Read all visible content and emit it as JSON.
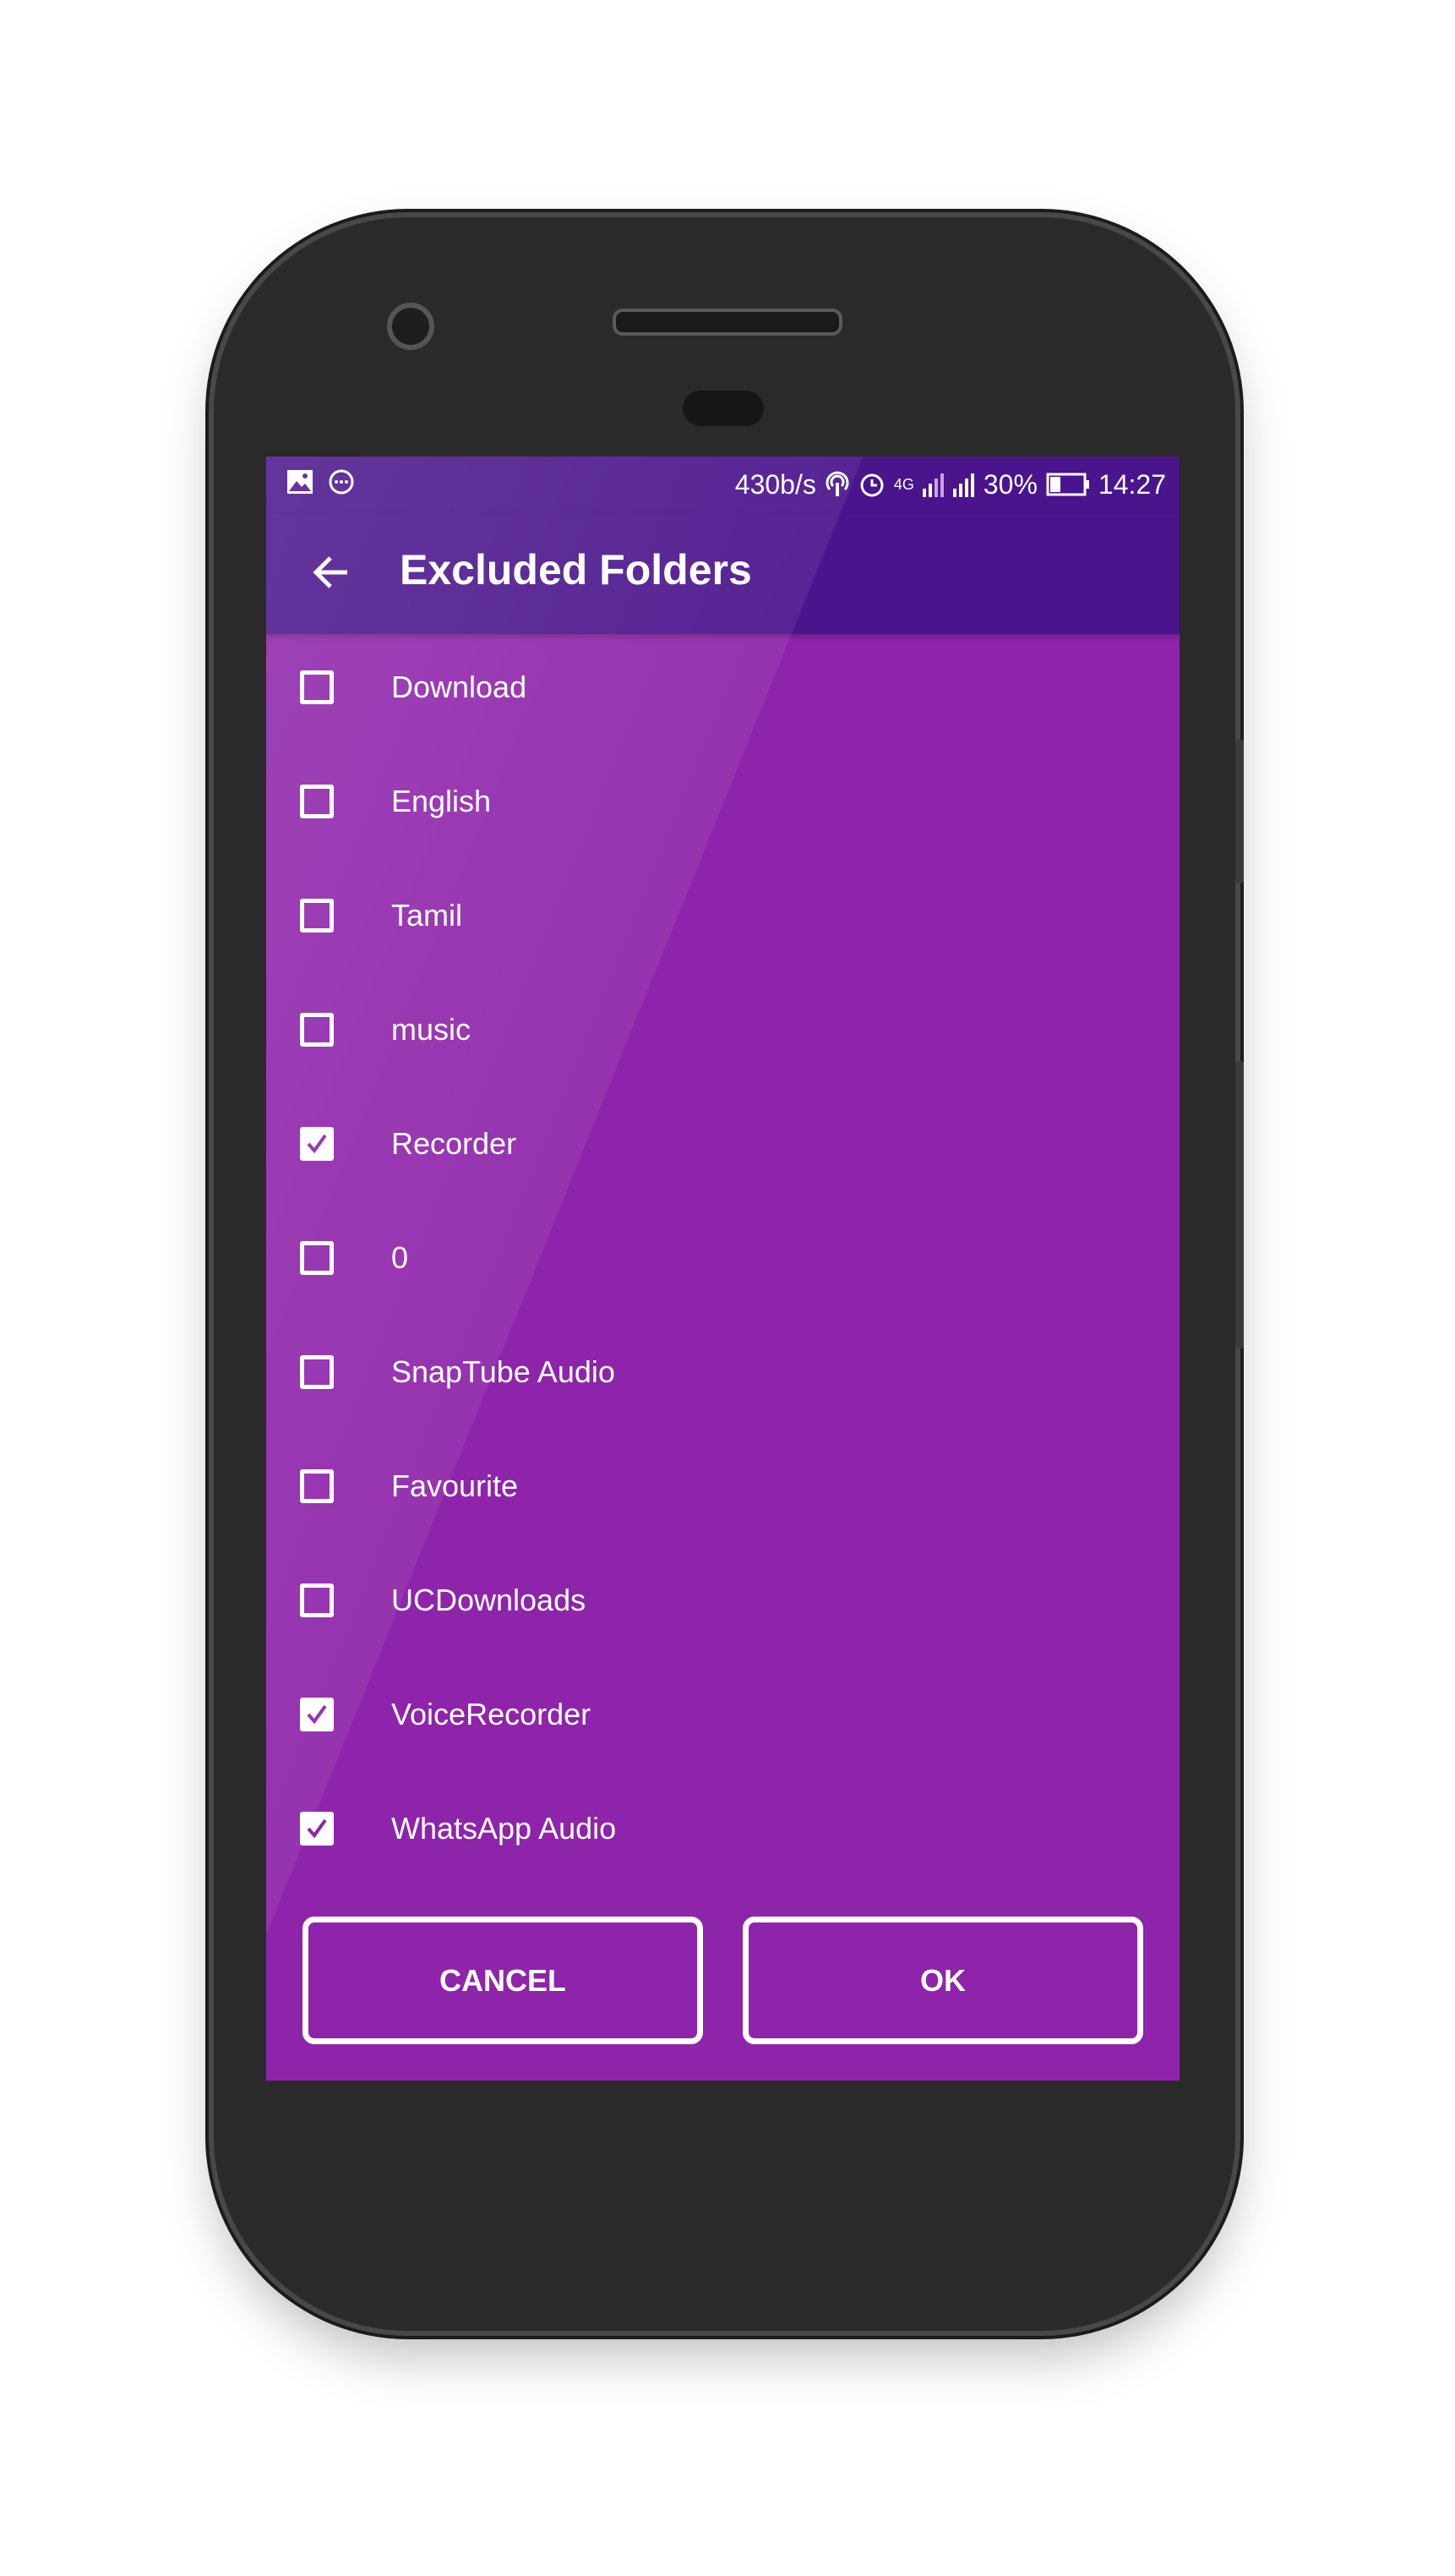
{
  "status_bar": {
    "net_speed": "430b/s",
    "network": "4G",
    "battery": "30%",
    "time": "14:27",
    "icons_left": [
      "image-icon",
      "more-circle-icon"
    ],
    "icons_right": [
      "hotspot-icon",
      "alarm-icon",
      "signal-icon",
      "signal-icon",
      "battery-icon"
    ]
  },
  "app_bar": {
    "title": "Excluded Folders",
    "back_icon": "arrow-left-icon"
  },
  "folders": [
    {
      "label": "Download",
      "checked": false
    },
    {
      "label": "English",
      "checked": false
    },
    {
      "label": "Tamil",
      "checked": false
    },
    {
      "label": "music",
      "checked": false
    },
    {
      "label": "Recorder",
      "checked": true
    },
    {
      "label": "0",
      "checked": false
    },
    {
      "label": "SnapTube Audio",
      "checked": false
    },
    {
      "label": "Favourite",
      "checked": false
    },
    {
      "label": "UCDownloads",
      "checked": false
    },
    {
      "label": "VoiceRecorder",
      "checked": true
    },
    {
      "label": "WhatsApp Audio",
      "checked": true
    }
  ],
  "buttons": {
    "cancel": "CANCEL",
    "ok": "OK"
  },
  "colors": {
    "primary": "#8e24aa",
    "primary_dark": "#4a148c",
    "text": "#ffffff"
  }
}
